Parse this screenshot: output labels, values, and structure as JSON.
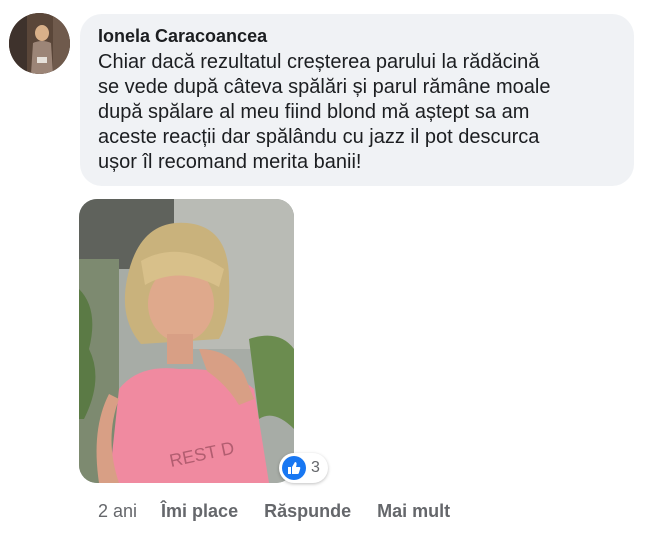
{
  "comment": {
    "author": "Ionela Caracoancea",
    "text": "Chiar dacă rezultatul creșterea parului la rădăcină\nse vede după câteva spălări și parul rămâne moale\ndupă spălare al meu fiind blond mă aștept sa am\naceste reacții dar spălându cu jazz il pot descurca\nușor îl recomand merita banii!",
    "photo_shirt_text": "REST D",
    "reactions": {
      "icon": "like-icon",
      "count": "3",
      "color": "#1877f2"
    },
    "actions": {
      "timestamp": "2 ani",
      "like_label": "Îmi place",
      "reply_label": "Răspunde",
      "more_label": "Mai mult"
    }
  },
  "colors": {
    "bubble_bg": "#f0f2f5",
    "text": "#1c1e21",
    "secondary_text": "#65676b"
  }
}
